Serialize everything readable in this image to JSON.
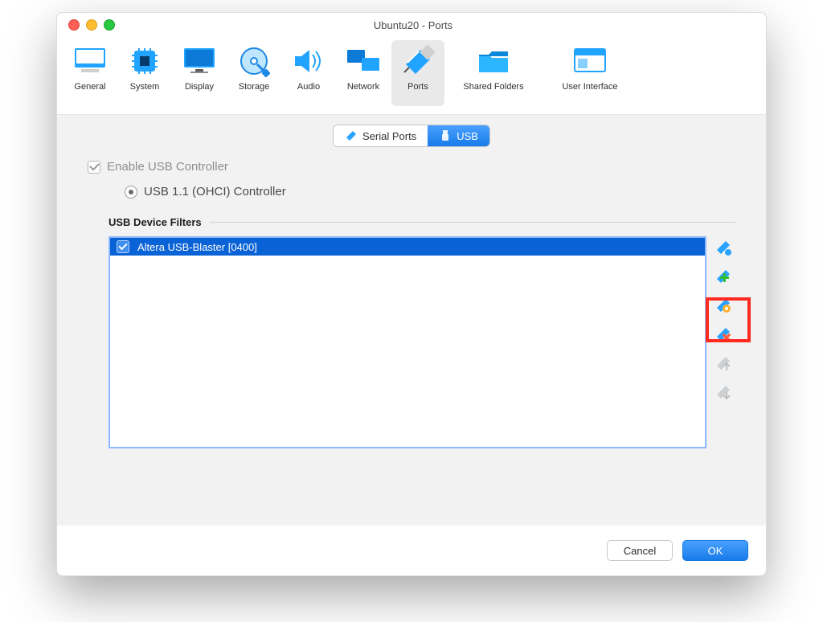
{
  "window": {
    "title": "Ubuntu20 - Ports"
  },
  "toolbar": {
    "items": [
      {
        "label": "General"
      },
      {
        "label": "System"
      },
      {
        "label": "Display"
      },
      {
        "label": "Storage"
      },
      {
        "label": "Audio"
      },
      {
        "label": "Network"
      },
      {
        "label": "Ports"
      },
      {
        "label": "Shared Folders"
      },
      {
        "label": "User Interface"
      }
    ],
    "selected_index": 6
  },
  "segments": {
    "serial": "Serial Ports",
    "usb": "USB",
    "active": "usb"
  },
  "usb": {
    "enable_label": "Enable USB Controller",
    "enable_checked": true,
    "controller_label": "USB 1.1 (OHCI) Controller",
    "controller_selected": true,
    "filters_title": "USB Device Filters",
    "filters": [
      {
        "checked": true,
        "label": "Altera USB-Blaster [0400]"
      }
    ],
    "side_buttons": [
      {
        "name": "add-empty-filter",
        "enabled": true
      },
      {
        "name": "add-from-device",
        "enabled": true,
        "highlight": true
      },
      {
        "name": "edit-filter",
        "enabled": true
      },
      {
        "name": "remove-filter",
        "enabled": true
      },
      {
        "name": "move-up",
        "enabled": false
      },
      {
        "name": "move-down",
        "enabled": false
      }
    ]
  },
  "footer": {
    "cancel": "Cancel",
    "ok": "OK"
  }
}
